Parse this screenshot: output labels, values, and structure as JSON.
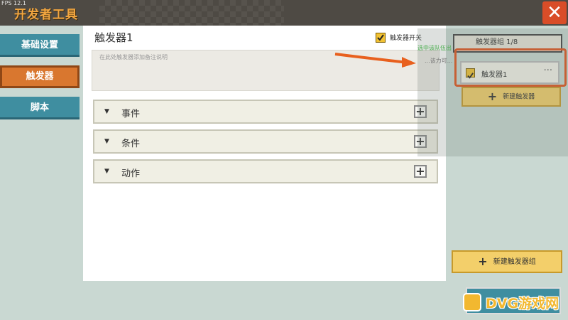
{
  "window": {
    "fps": "FPS 12.1",
    "title": "开发者工具",
    "close_icon": "close-icon"
  },
  "sidebar": {
    "items": [
      {
        "label": "基础设置",
        "active": false
      },
      {
        "label": "触发器",
        "active": true
      },
      {
        "label": "脚本",
        "active": false
      }
    ]
  },
  "main": {
    "trigger_name": "触发器1",
    "switch_label": "触发器开关",
    "switch_checked": true,
    "note_placeholder": "在此处触发器添加备注说明",
    "sections": [
      {
        "label": "事件"
      },
      {
        "label": "条件"
      },
      {
        "label": "动作"
      }
    ]
  },
  "right": {
    "group_tab_label": "触发器组 1/8",
    "tip_line1": "选中该队伍出",
    "tip_line2": "...该力可...",
    "trigger_item": {
      "label": "触发器1",
      "more": "···",
      "checked": true
    },
    "new_trigger_label": "新建触发器",
    "new_group_label": "新建触发器组"
  },
  "watermark": {
    "text": "DVG游戏网"
  },
  "colors": {
    "accent_orange": "#d9772f",
    "sidebar_blue": "#3f8ea0",
    "gold": "#f3cf6a",
    "highlight": "#e0541e"
  }
}
